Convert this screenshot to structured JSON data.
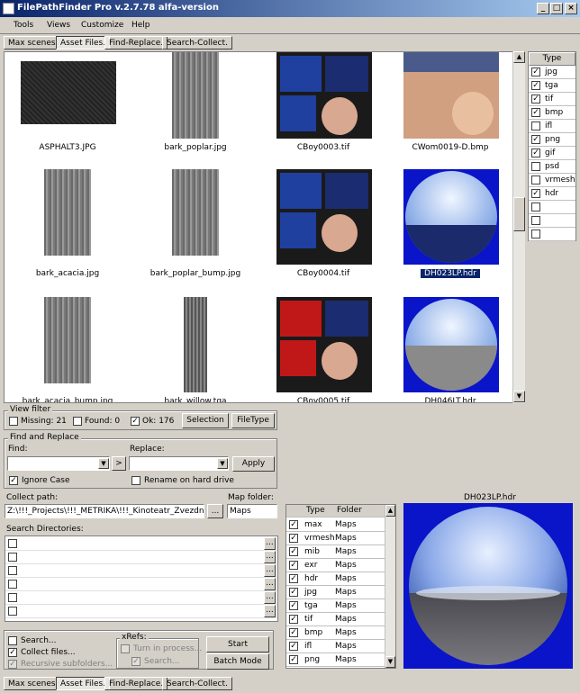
{
  "window": {
    "title": "FilePathFinder Pro v.2.7.78 alfa-version",
    "min": "_",
    "max": "□",
    "close": "×"
  },
  "menu": [
    "Tools",
    "Views",
    "Customize",
    "Help"
  ],
  "tabs": [
    "Max scenes.",
    "Asset Files.",
    "Find-Replace.",
    "Search-Collect."
  ],
  "gallery": {
    "items": [
      {
        "caption": "ASPHALT3.JPG",
        "selected": false,
        "kind": "asphalt"
      },
      {
        "caption": "bark_poplar.jpg",
        "selected": false,
        "kind": "bark"
      },
      {
        "caption": "CBoy0003.tif",
        "selected": false,
        "kind": "boy"
      },
      {
        "caption": "CWom0019-D.bmp",
        "selected": false,
        "kind": "woman"
      },
      {
        "caption": "bark_acacia.jpg",
        "selected": false,
        "kind": "bark"
      },
      {
        "caption": "bark_poplar_bump.jpg",
        "selected": false,
        "kind": "bark"
      },
      {
        "caption": "CBoy0004.tif",
        "selected": false,
        "kind": "boy"
      },
      {
        "caption": "DH023LP.hdr",
        "selected": true,
        "kind": "sphere"
      },
      {
        "caption": "bark_acacia_bump.jpg",
        "selected": false,
        "kind": "bark"
      },
      {
        "caption": "bark_willow.tga",
        "selected": false,
        "kind": "barknarrow"
      },
      {
        "caption": "CBoy0005.tif",
        "selected": false,
        "kind": "boyred"
      },
      {
        "caption": "DH046LT.hdr",
        "selected": false,
        "kind": "sphere2"
      }
    ]
  },
  "type_filter": {
    "header": "Type",
    "rows": [
      {
        "label": "jpg",
        "checked": true
      },
      {
        "label": "tga",
        "checked": true
      },
      {
        "label": "tif",
        "checked": true
      },
      {
        "label": "bmp",
        "checked": true
      },
      {
        "label": "ifl",
        "checked": false
      },
      {
        "label": "png",
        "checked": true
      },
      {
        "label": "gif",
        "checked": true
      },
      {
        "label": "psd",
        "checked": false
      },
      {
        "label": "vrmesh",
        "checked": false
      },
      {
        "label": "hdr",
        "checked": true
      },
      {
        "label": "",
        "checked": false
      },
      {
        "label": "",
        "checked": false
      },
      {
        "label": "",
        "checked": false
      }
    ]
  },
  "view_filter": {
    "title": "View filter",
    "missing": "Missing: 21",
    "found": "Found: 0",
    "ok": "Ok: 176",
    "ok_checked": true,
    "selection_button": "Selection",
    "filetype_button": "FileType"
  },
  "find_replace": {
    "title": "Find and Replace",
    "find_label": "Find:",
    "replace_label": "Replace:",
    "arrow_button": ">",
    "apply_button": "Apply",
    "ignore_case": "Ignore Case",
    "ignore_case_checked": true,
    "rename": "Rename on hard drive",
    "rename_checked": false
  },
  "collect": {
    "path_label": "Collect path:",
    "path_value": "Z:\\!!!_Projects\\!!!_METRIKA\\!!!_Kinoteatr_Zvezdniy\\w",
    "browse": "...",
    "map_folder_label": "Map folder:",
    "map_folder_value": "Maps",
    "search_dirs_label": "Search Directories:",
    "dir_rows": 6,
    "dir_browse": "..."
  },
  "options": {
    "search": "Search...",
    "collect_files": "Collect files...",
    "recursive": "Recursive subfolders...",
    "xrefs_title": "xRefs:",
    "turn_in_process": "Turn in process...",
    "xref_search": "Search...",
    "start_button": "Start",
    "batch_button": "Batch Mode"
  },
  "map_table": {
    "headers": [
      "Type",
      "Folder"
    ],
    "rows": [
      {
        "type": "max",
        "folder": "Maps",
        "checked": true
      },
      {
        "type": "vrmesh",
        "folder": "Maps",
        "checked": true
      },
      {
        "type": "mib",
        "folder": "Maps",
        "checked": true
      },
      {
        "type": "exr",
        "folder": "Maps",
        "checked": true
      },
      {
        "type": "hdr",
        "folder": "Maps",
        "checked": true
      },
      {
        "type": "jpg",
        "folder": "Maps",
        "checked": true
      },
      {
        "type": "tga",
        "folder": "Maps",
        "checked": true
      },
      {
        "type": "tif",
        "folder": "Maps",
        "checked": true
      },
      {
        "type": "bmp",
        "folder": "Maps",
        "checked": true
      },
      {
        "type": "ifl",
        "folder": "Maps",
        "checked": true
      },
      {
        "type": "png",
        "folder": "Maps",
        "checked": true
      }
    ]
  },
  "preview": {
    "title": "DH023LP.hdr"
  },
  "colors": {
    "selection": "#0a246a",
    "window_bg": "#d4d0c8",
    "preview_bg": "#0a14c8"
  }
}
